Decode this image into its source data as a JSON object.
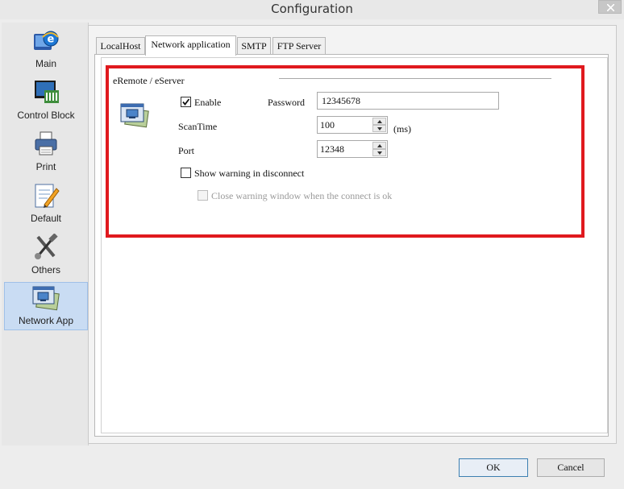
{
  "window": {
    "title": "Configuration"
  },
  "sidebar": {
    "items": [
      {
        "label": "Main",
        "icon": "ie-icon"
      },
      {
        "label": "Control Block",
        "icon": "monitor-icon"
      },
      {
        "label": "Print",
        "icon": "printer-icon"
      },
      {
        "label": "Default",
        "icon": "document-pencil-icon"
      },
      {
        "label": "Others",
        "icon": "tools-icon"
      },
      {
        "label": "Network App",
        "icon": "network-app-icon",
        "active": true
      }
    ]
  },
  "tabs": [
    {
      "label": "LocalHost"
    },
    {
      "label": "Network application",
      "active": true
    },
    {
      "label": "SMTP"
    },
    {
      "label": "FTP Server"
    }
  ],
  "group": {
    "title": "eRemote / eServer",
    "enable_label": "Enable",
    "enable_checked": true,
    "password_label": "Password",
    "password_value": "12345678",
    "scantime_label": "ScanTime",
    "scantime_value": "100",
    "scantime_unit": "(ms)",
    "port_label": "Port",
    "port_value": "12348",
    "show_warning_label": "Show warning in disconnect",
    "show_warning_checked": false,
    "close_warning_label": "Close warning window when the connect is ok",
    "close_warning_enabled": false
  },
  "buttons": {
    "ok": "OK",
    "cancel": "Cancel"
  },
  "colors": {
    "highlight_border": "#e0191e",
    "active_nav": "#c9dcf3"
  }
}
